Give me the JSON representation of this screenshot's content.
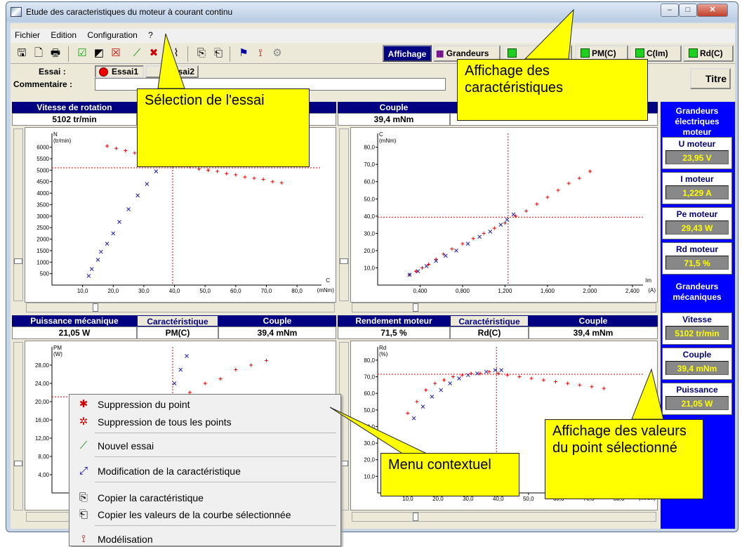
{
  "window": {
    "title": "Etude des caracteristiques du moteur à courant continu"
  },
  "menu": [
    "Fichier",
    "Edition",
    "Configuration",
    "?"
  ],
  "toolbar": {
    "affichage": "Affichage",
    "grandeurs": "Grandeurs",
    "toggles": [
      "PM(C)",
      "C(Im)",
      "Rd(C)"
    ],
    "titre": "Titre"
  },
  "essai": {
    "label": "Essai :",
    "essai1": "Essai1",
    "essai2": "Essai2",
    "comment_label": "Commentaire :"
  },
  "panels": {
    "tl": {
      "h1": "Vitesse de rotation",
      "v1": "5102 tr/min"
    },
    "tr": {
      "h1": "Couple",
      "v1": "39,4 mNm"
    },
    "bl": {
      "h1": "Puissance mécanique",
      "h2": "Caractéristique",
      "h3": "Couple",
      "v1": "21,05 W",
      "v2": "PM(C)",
      "v3": "39,4 mNm"
    },
    "br": {
      "h1": "Rendement moteur",
      "h2": "Caractéristique",
      "h3": "Couple",
      "v1": "71,5 %",
      "v2": "Rd(C)",
      "v3": "39,4 mNm"
    }
  },
  "plots": {
    "tl": {
      "ylabel": "N",
      "yunit": "(tr/min)",
      "xlabel": "C",
      "xunit": "(mNm)",
      "yticks": [
        "6000",
        "5500",
        "5000",
        "4500",
        "4000",
        "3500",
        "3000",
        "2500",
        "2000",
        "1500",
        "1000",
        "500"
      ],
      "xticks": [
        "10,0",
        "20,0",
        "30,0",
        "40,0",
        "50,0",
        "60,0",
        "70,0",
        "80,0"
      ]
    },
    "tr": {
      "ylabel": "C",
      "yunit": "(mNm)",
      "xlabel": "Im",
      "xunit": "(A)",
      "yticks": [
        "80,0",
        "70,0",
        "60,0",
        "50,0",
        "40,0",
        "30,0",
        "20,0",
        "10,0"
      ],
      "xticks": [
        "0,400",
        "0,800",
        "1,200",
        "1,600",
        "2,000",
        "2,400"
      ]
    },
    "bl": {
      "ylabel": "PM",
      "yunit": "(W)",
      "yticks": [
        "28,00",
        "24,00",
        "20,00",
        "16,00",
        "12,00",
        "8,00",
        "4,00"
      ]
    },
    "br": {
      "ylabel": "Rd",
      "yunit": "(%)",
      "yticks": [
        "80,0",
        "70,0",
        "60,0",
        "50,0",
        "40,0",
        "30,0",
        "20,0",
        "10,0"
      ],
      "xticks": [
        "10,0",
        "20,0",
        "30,0",
        "40,0",
        "50,0",
        "60,0",
        "70,0",
        "80,0"
      ],
      "xunit": "(mNm)"
    }
  },
  "chart_data": [
    {
      "type": "scatter",
      "xlabel": "C",
      "ylabel": "N",
      "series": [
        {
          "values": [
            [
              18,
              6050
            ],
            [
              21,
              5950
            ],
            [
              24,
              5850
            ],
            [
              27,
              5750
            ],
            [
              30,
              5650
            ],
            [
              33,
              5500
            ],
            [
              36,
              5400
            ],
            [
              39,
              5300
            ],
            [
              42,
              5200
            ],
            [
              45,
              5150
            ],
            [
              48,
              5050
            ],
            [
              51,
              5000
            ],
            [
              54,
              4950
            ],
            [
              57,
              4850
            ],
            [
              60,
              4800
            ],
            [
              63,
              4700
            ],
            [
              66,
              4650
            ],
            [
              69,
              4600
            ],
            [
              72,
              4500
            ],
            [
              75,
              4450
            ]
          ]
        },
        {
          "values": [
            [
              12,
              400
            ],
            [
              13,
              700
            ],
            [
              15,
              1100
            ],
            [
              16,
              1450
            ],
            [
              18,
              1800
            ],
            [
              20,
              2250
            ],
            [
              22,
              2750
            ],
            [
              25,
              3300
            ],
            [
              28,
              3900
            ],
            [
              31,
              4400
            ],
            [
              34,
              4950
            ],
            [
              37,
              5300
            ],
            [
              39,
              5500
            ]
          ]
        }
      ]
    },
    {
      "type": "scatter",
      "xlabel": "Im",
      "ylabel": "C",
      "series": [
        {
          "values": [
            [
              0.3,
              6
            ],
            [
              0.36,
              8
            ],
            [
              0.42,
              10
            ],
            [
              0.48,
              12
            ],
            [
              0.55,
              15
            ],
            [
              0.62,
              18
            ],
            [
              0.7,
              21
            ],
            [
              0.8,
              24
            ],
            [
              0.9,
              27
            ],
            [
              1.0,
              30
            ],
            [
              1.1,
              33
            ],
            [
              1.2,
              36
            ],
            [
              1.3,
              40
            ],
            [
              1.4,
              43
            ],
            [
              1.5,
              47
            ],
            [
              1.6,
              51
            ],
            [
              1.7,
              55
            ],
            [
              1.8,
              59
            ],
            [
              1.9,
              62
            ],
            [
              2.0,
              66
            ]
          ]
        },
        {
          "values": [
            [
              0.3,
              6
            ],
            [
              0.38,
              8
            ],
            [
              0.46,
              11
            ],
            [
              0.55,
              14
            ],
            [
              0.64,
              17
            ],
            [
              0.74,
              20
            ],
            [
              0.85,
              24
            ],
            [
              0.96,
              28
            ],
            [
              1.06,
              31
            ],
            [
              1.16,
              35
            ],
            [
              1.22,
              38
            ],
            [
              1.28,
              41
            ]
          ]
        }
      ]
    },
    {
      "type": "scatter",
      "xlabel": "C",
      "ylabel": "PM",
      "series": [
        {
          "values": [
            [
              15,
              3
            ],
            [
              20,
              5
            ],
            [
              25,
              8
            ],
            [
              30,
              11
            ],
            [
              33,
              14
            ],
            [
              36,
              17
            ],
            [
              40,
              20
            ],
            [
              45,
              22
            ],
            [
              50,
              24
            ],
            [
              55,
              25
            ],
            [
              60,
              27
            ],
            [
              65,
              28
            ],
            [
              70,
              29
            ]
          ]
        },
        {
          "values": [
            [
              12,
              1
            ],
            [
              15,
              2
            ],
            [
              40,
              24
            ],
            [
              42,
              27
            ],
            [
              44,
              30
            ]
          ]
        }
      ]
    },
    {
      "type": "scatter",
      "xlabel": "C",
      "ylabel": "Rd",
      "series": [
        {
          "values": [
            [
              10,
              48
            ],
            [
              13,
              55
            ],
            [
              16,
              62
            ],
            [
              19,
              66
            ],
            [
              22,
              68
            ],
            [
              25,
              70
            ],
            [
              28,
              71
            ],
            [
              31,
              72
            ],
            [
              34,
              72
            ],
            [
              37,
              73
            ],
            [
              40,
              72
            ],
            [
              43,
              71
            ],
            [
              47,
              70
            ],
            [
              51,
              69
            ],
            [
              55,
              68
            ],
            [
              59,
              67
            ],
            [
              63,
              66
            ],
            [
              67,
              65
            ],
            [
              71,
              64
            ],
            [
              75,
              63
            ]
          ]
        },
        {
          "values": [
            [
              12,
              45
            ],
            [
              15,
              52
            ],
            [
              18,
              58
            ],
            [
              21,
              62
            ],
            [
              24,
              66
            ],
            [
              27,
              69
            ],
            [
              30,
              71
            ],
            [
              33,
              72
            ],
            [
              36,
              73
            ],
            [
              39,
              74
            ],
            [
              41,
              74
            ]
          ]
        }
      ]
    }
  ],
  "rpanel": {
    "head1": "Grandeurs électriques moteur",
    "cards1": [
      {
        "title": "U moteur",
        "value": "23,95 V"
      },
      {
        "title": "I moteur",
        "value": "1,229 A"
      },
      {
        "title": "Pe moteur",
        "value": "29,43 W"
      },
      {
        "title": "Rd moteur",
        "value": "71,5 %"
      }
    ],
    "head2": "Grandeurs mécaniques",
    "cards2": [
      {
        "title": "Vitesse",
        "value": "5102 tr/min"
      },
      {
        "title": "Couple",
        "value": "39,4 mNm"
      },
      {
        "title": "Puissance",
        "value": "21,05 W"
      }
    ]
  },
  "context_menu": [
    {
      "label": "Suppression du point",
      "icon": "delete-point-icon"
    },
    {
      "label": "Suppression de tous les points",
      "icon": "delete-all-icon"
    },
    {
      "label": "Nouvel essai",
      "icon": "new-test-icon"
    },
    {
      "label": "Modification de la caractéristique",
      "icon": "edit-curve-icon"
    },
    {
      "label": "Copier la caractéristique",
      "icon": "copy-icon"
    },
    {
      "label": "Copier les valeurs de la courbe sélectionnée",
      "icon": "copy-values-icon"
    },
    {
      "label": "Modélisation",
      "icon": "model-icon"
    }
  ],
  "callouts": {
    "essai": "Sélection de l'essai",
    "affichage": "Affichage des caractéristiques",
    "menu": "Menu contextuel",
    "valeurs": "Affichage des valeurs du point sélectionné"
  }
}
